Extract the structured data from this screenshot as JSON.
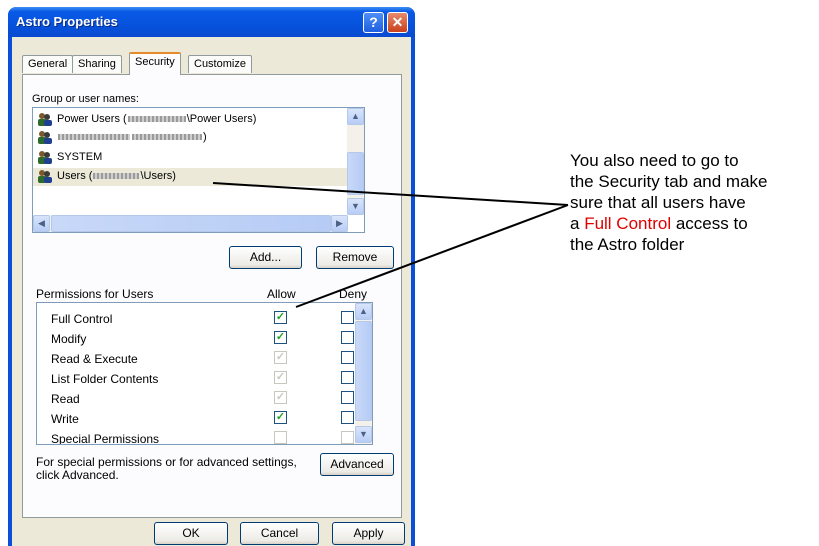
{
  "window": {
    "title": "Astro Properties",
    "help_glyph": "?",
    "close_glyph": "✕"
  },
  "tabs": [
    {
      "label": "General"
    },
    {
      "label": "Sharing"
    },
    {
      "label": "Security"
    },
    {
      "label": "Customize"
    }
  ],
  "security": {
    "group_label": "Group or user names:",
    "users": [
      {
        "name": "Power Users (",
        "suffix": "\\Power Users)"
      },
      {
        "name": "",
        "suffix": ")"
      },
      {
        "name": "SYSTEM",
        "suffix": ""
      },
      {
        "name": "Users (",
        "suffix": "\\Users)"
      }
    ],
    "add_button": "Add...",
    "remove_button": "Remove",
    "permissions_label": "Permissions for Users",
    "allow_header": "Allow",
    "deny_header": "Deny",
    "permissions": [
      {
        "name": "Full Control",
        "allow": "✓",
        "deny": ""
      },
      {
        "name": "Modify",
        "allow": "✓",
        "deny": ""
      },
      {
        "name": "Read & Execute",
        "allow": "✓",
        "deny": ""
      },
      {
        "name": "List Folder Contents",
        "allow": "✓",
        "deny": ""
      },
      {
        "name": "Read",
        "allow": "✓",
        "deny": ""
      },
      {
        "name": "Write",
        "allow": "✓",
        "deny": ""
      },
      {
        "name": "Special Permissions",
        "allow": "",
        "deny": ""
      }
    ],
    "advanced_text_line1": "For special permissions or for advanced settings,",
    "advanced_text_line2": "click Advanced.",
    "advanced_button": "Advanced"
  },
  "footer": {
    "ok": "OK",
    "cancel": "Cancel",
    "apply": "Apply"
  },
  "annotation": {
    "line1": "You also need to go to",
    "line2": "the Security tab and make",
    "line3": "sure  that all users have",
    "line4_prefix": "a ",
    "line4_highlight": "Full Control",
    "line4_suffix": " access to",
    "line5": "the Astro folder"
  },
  "colors": {
    "titlebar": "#0652dd",
    "annotation_highlight": "#e00000",
    "check_green": "#21a121"
  }
}
